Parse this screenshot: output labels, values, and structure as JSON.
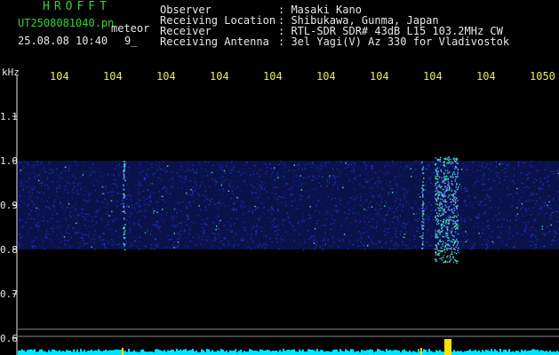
{
  "header": {
    "app_title": "HROFFT",
    "filename": "UT2508081040.pn",
    "meteor_label": "meteor",
    "timestamp": "25.08.08 10:40",
    "count": "9_",
    "fields": [
      {
        "label": "Observer",
        "value": ": Masaki Kano"
      },
      {
        "label": "Receiving Location",
        "value": ": Shibukawa, Gunma, Japan"
      },
      {
        "label": "Receiver",
        "value": ": RTL-SDR SDR# 43dB L15 103.2MHz CW"
      },
      {
        "label": "Receiving Antenna",
        "value": ": 3el Yagi(V) Az 330 for Vladivostok"
      }
    ]
  },
  "chart_data": {
    "type": "heatmap",
    "ylabel": "kHz",
    "x_tick_labels": [
      "104",
      "104",
      "104",
      "104",
      "104",
      "104",
      "104",
      "104",
      "104",
      "1050"
    ],
    "y_tick_labels": [
      "1.1",
      "1.0",
      "0.9",
      "0.8",
      "0.7",
      "0.6"
    ],
    "y_ticks": [
      1.1,
      1.0,
      0.9,
      0.8,
      0.7,
      0.6
    ],
    "ylim": [
      0.58,
      1.15
    ],
    "noise_band": [
      0.8,
      1.0
    ],
    "meteor_events": [
      {
        "time_index": 1.25,
        "freq_range": [
          0.8,
          1.0
        ],
        "strength": "weak"
      },
      {
        "time_index": 6.85,
        "freq_range": [
          0.8,
          1.0
        ],
        "strength": "weak"
      },
      {
        "time_index": 7.3,
        "freq_range": [
          0.77,
          1.01
        ],
        "strength": "strong"
      }
    ],
    "colors": {
      "axis": "#e8e8e8",
      "tick_label": "#e8e860",
      "noise": "#1e32c8",
      "signal": "#3ce6a0",
      "timeline": "#00e5ff",
      "event": "#ffe000"
    }
  }
}
